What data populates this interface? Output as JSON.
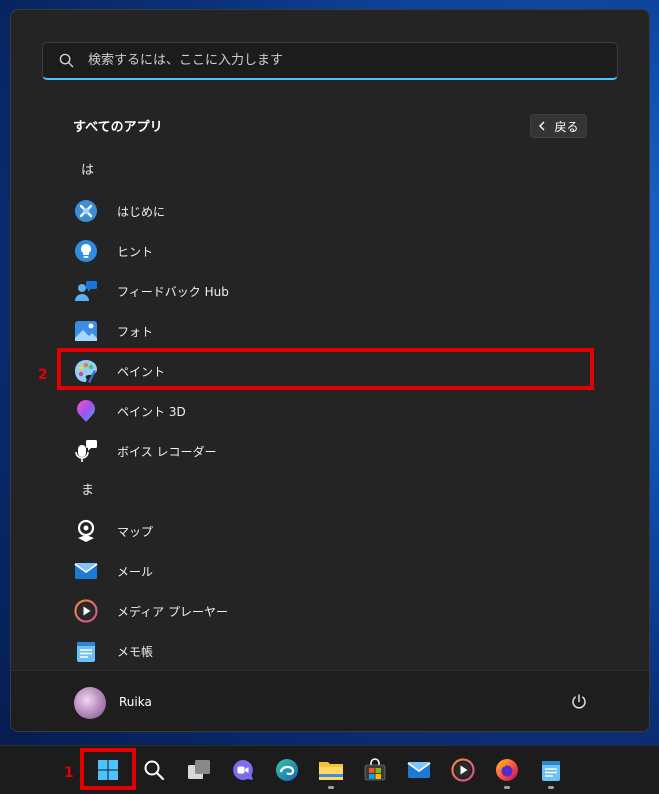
{
  "search": {
    "placeholder": "検索するには、ここに入力します"
  },
  "all_apps": {
    "title": "すべてのアプリ",
    "back_label": "戻る"
  },
  "app_list": [
    {
      "kind": "header",
      "label": "は"
    },
    {
      "kind": "app",
      "label": "はじめに",
      "icon": "get-started-icon"
    },
    {
      "kind": "app",
      "label": "ヒント",
      "icon": "tips-icon"
    },
    {
      "kind": "app",
      "label": "フィードバック Hub",
      "icon": "feedback-hub-icon"
    },
    {
      "kind": "app",
      "label": "フォト",
      "icon": "photos-icon"
    },
    {
      "kind": "app",
      "label": "ペイント",
      "icon": "paint-icon"
    },
    {
      "kind": "app",
      "label": "ペイント 3D",
      "icon": "paint-3d-icon"
    },
    {
      "kind": "app",
      "label": "ボイス レコーダー",
      "icon": "voice-recorder-icon"
    },
    {
      "kind": "header",
      "label": "ま"
    },
    {
      "kind": "app",
      "label": "マップ",
      "icon": "maps-icon"
    },
    {
      "kind": "app",
      "label": "メール",
      "icon": "mail-icon"
    },
    {
      "kind": "app",
      "label": "メディア プレーヤー",
      "icon": "media-player-icon"
    },
    {
      "kind": "app",
      "label": "メモ帳",
      "icon": "notepad-icon"
    }
  ],
  "user": {
    "name": "Ruika"
  },
  "annotations": {
    "start_marker": "1",
    "paint_marker": "2",
    "highlight_color": "#e30000"
  },
  "taskbar": [
    {
      "name": "start-button",
      "icon": "windows-logo-icon",
      "dot": false
    },
    {
      "name": "taskbar-search-button",
      "icon": "search-icon",
      "dot": false
    },
    {
      "name": "task-view-button",
      "icon": "task-view-icon",
      "dot": false
    },
    {
      "name": "taskbar-chat-button",
      "icon": "chat-icon",
      "dot": false
    },
    {
      "name": "taskbar-edge-button",
      "icon": "edge-icon",
      "dot": false
    },
    {
      "name": "taskbar-explorer-button",
      "icon": "file-explorer-icon",
      "dot": true
    },
    {
      "name": "taskbar-store-button",
      "icon": "store-icon",
      "dot": false
    },
    {
      "name": "taskbar-mail-button",
      "icon": "mail-icon",
      "dot": false
    },
    {
      "name": "taskbar-media-player-button",
      "icon": "media-player-icon",
      "dot": false
    },
    {
      "name": "taskbar-firefox-button",
      "icon": "firefox-icon",
      "dot": true
    },
    {
      "name": "taskbar-notepad-button",
      "icon": "notepad-icon",
      "dot": true
    }
  ]
}
